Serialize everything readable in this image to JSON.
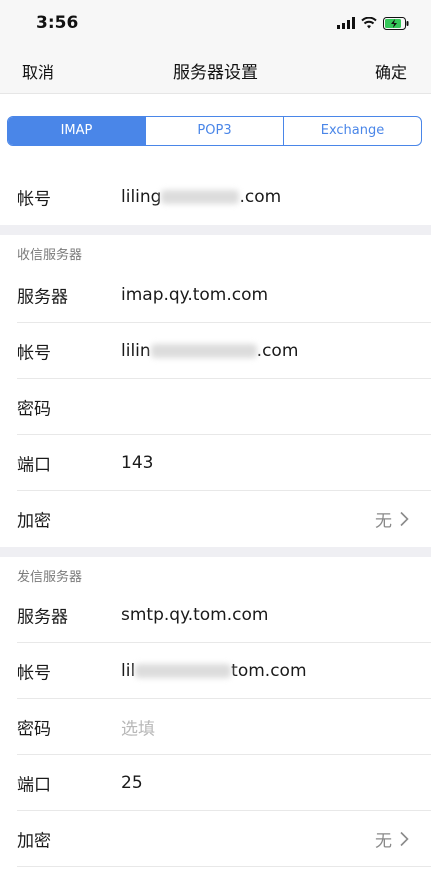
{
  "status": {
    "time": "3:56"
  },
  "nav": {
    "cancel": "取消",
    "title": "服务器设置",
    "confirm": "确定"
  },
  "tabs": [
    {
      "label": "IMAP",
      "active": true
    },
    {
      "label": "POP3",
      "active": false
    },
    {
      "label": "Exchange",
      "active": false
    }
  ],
  "account": {
    "label": "帐号",
    "prefix": "liling",
    "suffix": ".com"
  },
  "incoming": {
    "header": "收信服务器",
    "server": {
      "label": "服务器",
      "value": "imap.qy.tom.com"
    },
    "account": {
      "label": "帐号",
      "prefix": "lilin",
      "suffix": ".com"
    },
    "password": {
      "label": "密码",
      "value": ""
    },
    "port": {
      "label": "端口",
      "value": "143"
    },
    "encryption": {
      "label": "加密",
      "value": "无"
    }
  },
  "outgoing": {
    "header": "发信服务器",
    "server": {
      "label": "服务器",
      "value": "smtp.qy.tom.com"
    },
    "account": {
      "label": "帐号",
      "prefix": "lil",
      "suffix": "tom.com"
    },
    "password": {
      "label": "密码",
      "placeholder": "选填"
    },
    "port": {
      "label": "端口",
      "value": "25"
    },
    "encryption": {
      "label": "加密",
      "value": "无"
    }
  },
  "colors": {
    "accent": "#4a86e8",
    "separator": "#efeff3"
  },
  "icons": [
    "signal-icon",
    "wifi-icon",
    "battery-charging-icon",
    "chevron-right-icon"
  ]
}
